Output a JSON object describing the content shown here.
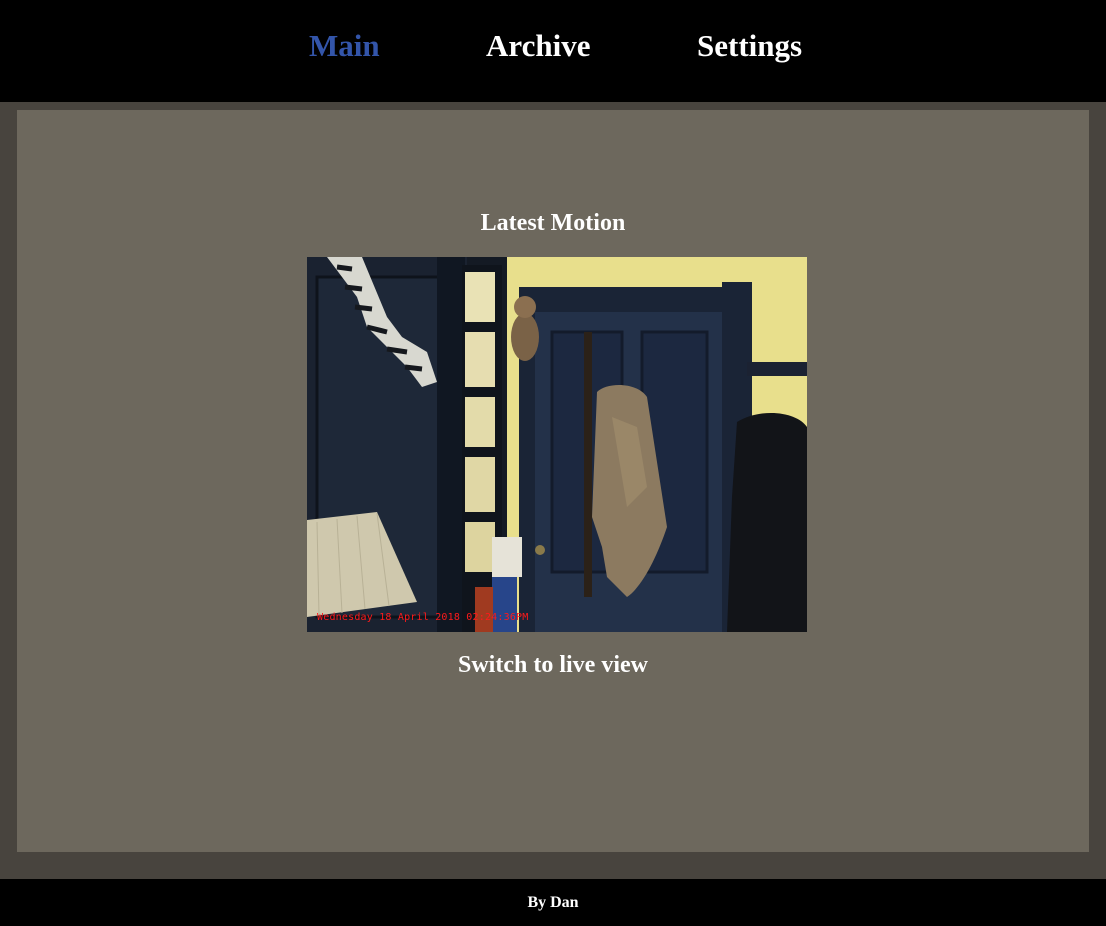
{
  "nav": {
    "items": [
      {
        "label": "Main",
        "active": true
      },
      {
        "label": "Archive",
        "active": false
      },
      {
        "label": "Settings",
        "active": false
      }
    ],
    "active_color": "#3355aa"
  },
  "main": {
    "section_title": "Latest Motion",
    "snapshot": {
      "timestamp": "Wednesday 18 April 2018 02:24:36PM"
    },
    "live_view_label": "Switch to live view"
  },
  "footer": {
    "text": "By Dan"
  }
}
